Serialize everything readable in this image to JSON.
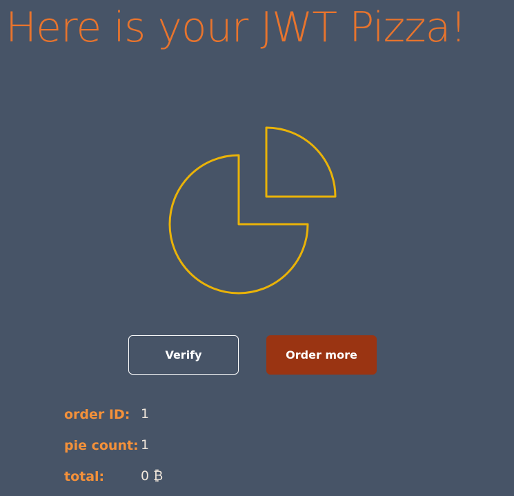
{
  "header": {
    "title": "Here is your JWT Pizza!"
  },
  "graphic": {
    "icon": "pizza-slice-icon",
    "stroke_color": "#eab308"
  },
  "actions": {
    "verify_label": "Verify",
    "order_more_label": "Order more"
  },
  "order": {
    "id_label": "order ID:",
    "id_value": "1",
    "pie_count_label": "pie count:",
    "pie_count_value": "1",
    "total_label": "total:",
    "total_value": "0 ₿"
  },
  "colors": {
    "background": "#475467",
    "accent": "#e8742d",
    "order_button": "#9a3412"
  }
}
